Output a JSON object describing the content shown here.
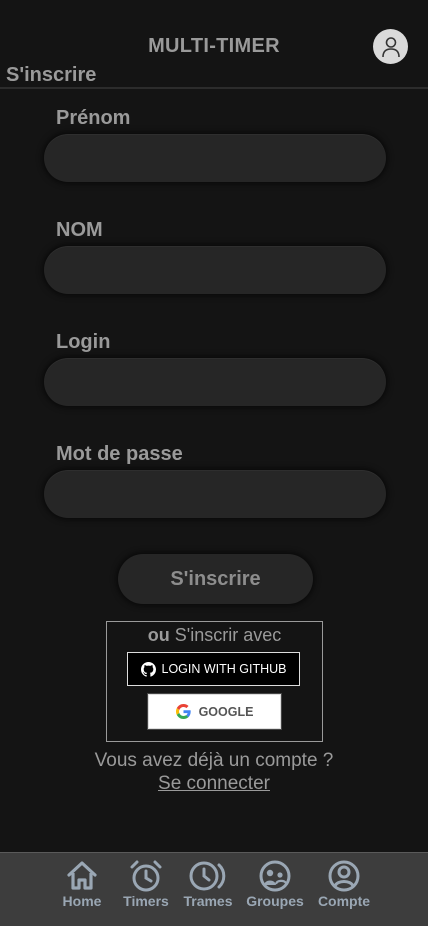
{
  "header": {
    "app_title": "MULTI-TIMER",
    "page_title": "S'inscrire"
  },
  "form": {
    "firstname_label": "Prénom",
    "lastname_label": "NOM",
    "login_label": "Login",
    "password_label": "Mot de passe",
    "firstname_value": "",
    "lastname_value": "",
    "login_value": "",
    "password_value": "",
    "submit_label": "S'inscrire"
  },
  "oauth": {
    "or_word": "ou",
    "title_rest": " S'inscrir avec",
    "github_label": "LOGIN WITH GITHUB",
    "google_label": "GOOGLE"
  },
  "footer": {
    "already_text": "Vous avez déjà un compte ?",
    "login_link": "Se connecter"
  },
  "nav": {
    "items": [
      {
        "label": "Home",
        "icon": "home-icon"
      },
      {
        "label": "Timers",
        "icon": "alarm-clock-icon"
      },
      {
        "label": "Trames",
        "icon": "history-icon"
      },
      {
        "label": "Groupes",
        "icon": "group-icon"
      },
      {
        "label": "Compte",
        "icon": "account-icon"
      }
    ]
  },
  "colors": {
    "background": "#141414",
    "text": "#9a9a9a",
    "nav_background": "#3d3d3d",
    "nav_icon": "#9aa7b4"
  }
}
